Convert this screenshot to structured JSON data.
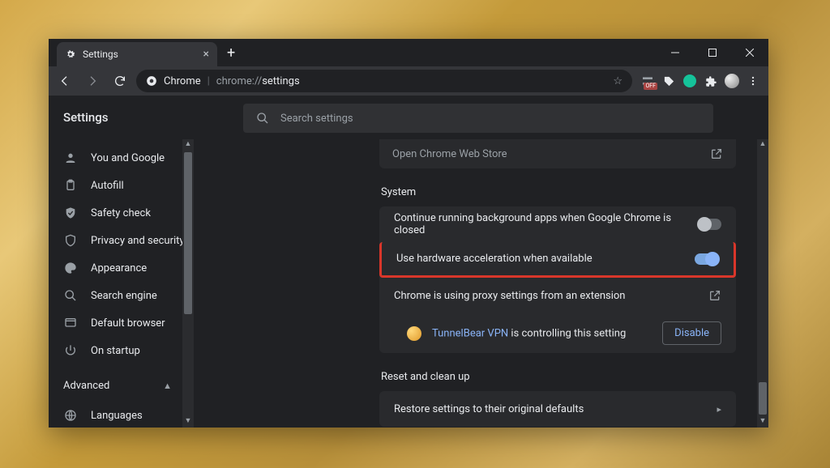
{
  "window": {
    "tab_title": "Settings",
    "new_tab_tooltip": "New tab"
  },
  "omnibox": {
    "scheme_label": "Chrome",
    "path": "chrome://settings",
    "path_highlight": "settings"
  },
  "toolbar_ext": {
    "off_badge": "OFF"
  },
  "settings": {
    "title": "Settings",
    "search_placeholder": "Search settings"
  },
  "sidebar": {
    "items": [
      {
        "label": "You and Google",
        "icon": "person-icon"
      },
      {
        "label": "Autofill",
        "icon": "clipboard-icon"
      },
      {
        "label": "Safety check",
        "icon": "check-shield-icon"
      },
      {
        "label": "Privacy and security",
        "icon": "shield-icon"
      },
      {
        "label": "Appearance",
        "icon": "palette-icon"
      },
      {
        "label": "Search engine",
        "icon": "magnify-icon"
      },
      {
        "label": "Default browser",
        "icon": "browser-icon"
      },
      {
        "label": "On startup",
        "icon": "power-icon"
      }
    ],
    "advanced_label": "Advanced",
    "advanced_items": [
      {
        "label": "Languages",
        "icon": "globe-icon"
      }
    ]
  },
  "main": {
    "webstore_link": "Open Chrome Web Store",
    "section_system": "System",
    "row_bg_apps": "Continue running background apps when Google Chrome is closed",
    "row_hw_accel": "Use hardware acceleration when available",
    "row_proxy": "Chrome is using proxy settings from an extension",
    "controlling_ext_name": "TunnelBear VPN",
    "controlling_suffix": " is controlling this setting",
    "disable_label": "Disable",
    "section_reset": "Reset and clean up",
    "row_restore": "Restore settings to their original defaults"
  }
}
